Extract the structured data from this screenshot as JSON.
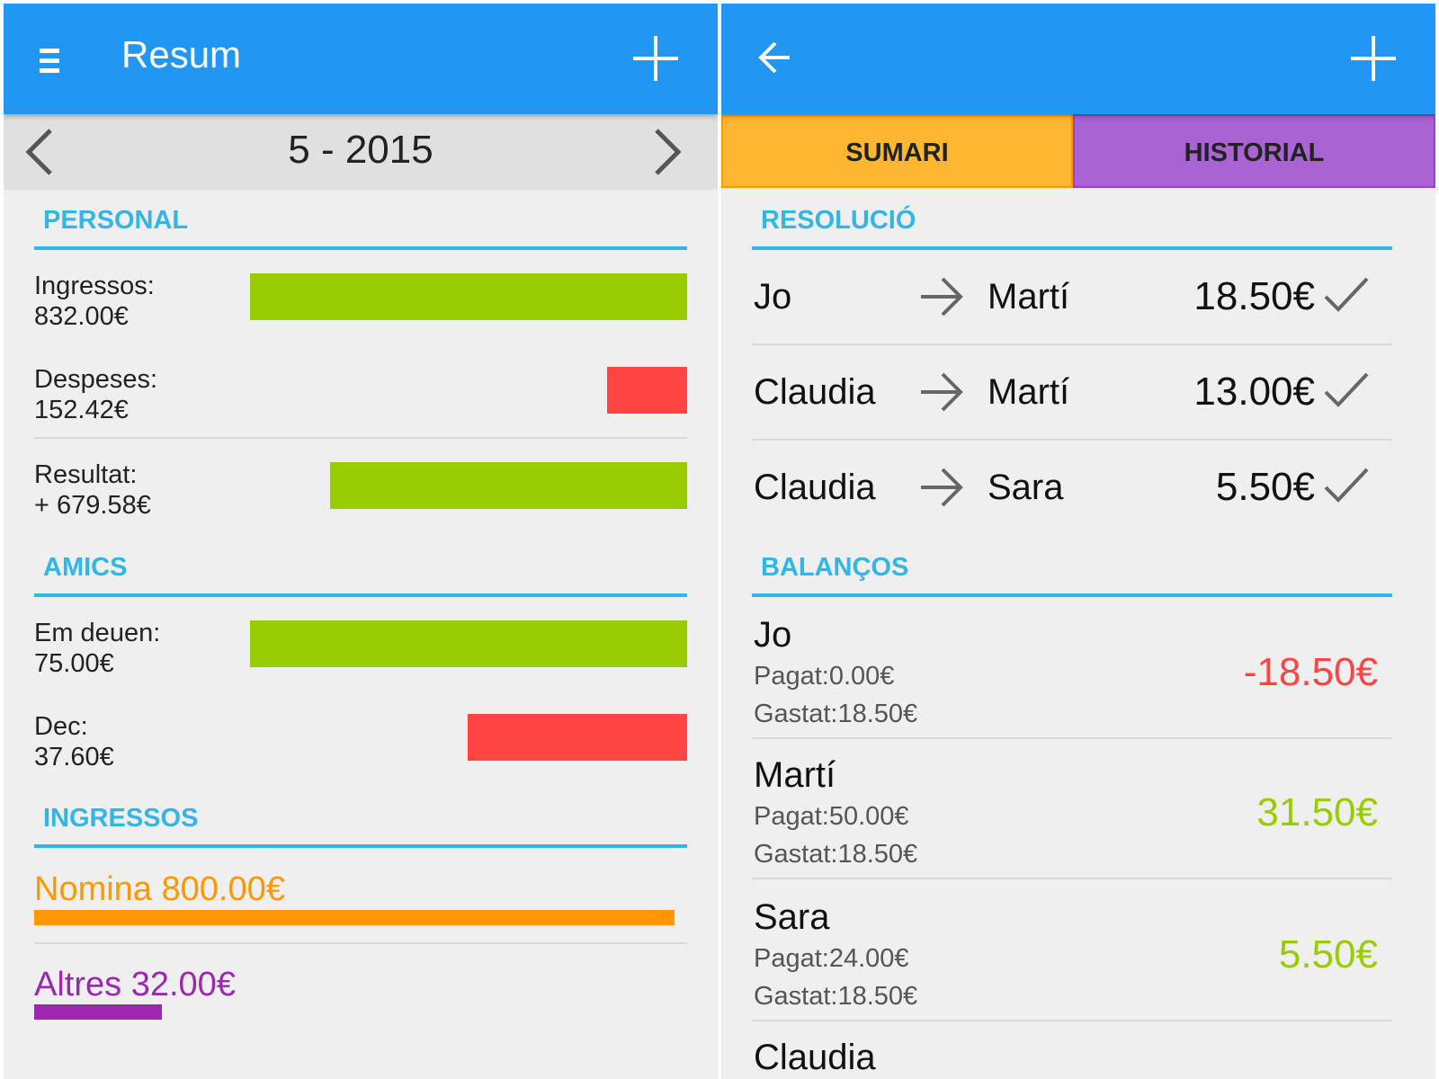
{
  "left": {
    "appbar": {
      "title": "Resum",
      "menu_icon": "hamburger-menu-icon",
      "add_icon": "plus-icon"
    },
    "month": {
      "label": "5 - 2015",
      "prev_icon": "chevron-left-icon",
      "next_icon": "chevron-right-icon"
    },
    "personal": {
      "title": "PERSONAL",
      "items": [
        {
          "label": "Ingressos:",
          "value": "832.00€",
          "amount": 832.0,
          "color": "#99cc00"
        },
        {
          "label": "Despeses:",
          "value": "152.42€",
          "amount": 152.42,
          "color": "#ff4444"
        },
        {
          "label": "Resultat:",
          "value": "+ 679.58€",
          "amount": 679.58,
          "color": "#99cc00"
        }
      ]
    },
    "amics": {
      "title": "AMICS",
      "items": [
        {
          "label": "Em deuen:",
          "value": "75.00€",
          "amount": 75.0,
          "color": "#99cc00"
        },
        {
          "label": "Dec:",
          "value": "37.60€",
          "amount": 37.6,
          "color": "#ff4444"
        }
      ]
    },
    "ingressos": {
      "title": "INGRESSOS",
      "items": [
        {
          "label": "Nomina 800.00€",
          "amount": 800.0,
          "color": "#ff9800"
        },
        {
          "label": "Altres 32.00€",
          "amount": 32.0,
          "color": "#9c27b0"
        }
      ]
    }
  },
  "right": {
    "appbar": {
      "back_icon": "arrow-left-icon",
      "add_icon": "plus-icon"
    },
    "tabs": [
      {
        "label": "SUMARI",
        "active": true,
        "color": "#ffb732"
      },
      {
        "label": "HISTORIAL",
        "active": false,
        "color": "#a963d3"
      }
    ],
    "resolucio": {
      "title": "RESOLUCIÓ",
      "rows": [
        {
          "from": "Jo",
          "to": "Martí",
          "amount": "18.50€",
          "check_icon": "checkmark-icon"
        },
        {
          "from": "Claudia",
          "to": "Martí",
          "amount": "13.00€",
          "check_icon": "checkmark-icon"
        },
        {
          "from": "Claudia",
          "to": "Sara",
          "amount": "5.50€",
          "check_icon": "checkmark-icon"
        }
      ]
    },
    "balancos": {
      "title": "BALANÇOS",
      "items": [
        {
          "name": "Jo",
          "paid": "Pagat:0.00€",
          "spent": "Gastat:18.50€",
          "balance": "-18.50€",
          "color": "#ff4444"
        },
        {
          "name": "Martí",
          "paid": "Pagat:50.00€",
          "spent": "Gastat:18.50€",
          "balance": "31.50€",
          "color": "#99cc00"
        },
        {
          "name": "Sara",
          "paid": "Pagat:24.00€",
          "spent": "Gastat:18.50€",
          "balance": "5.50€",
          "color": "#99cc00"
        },
        {
          "name": "Claudia"
        }
      ]
    }
  }
}
